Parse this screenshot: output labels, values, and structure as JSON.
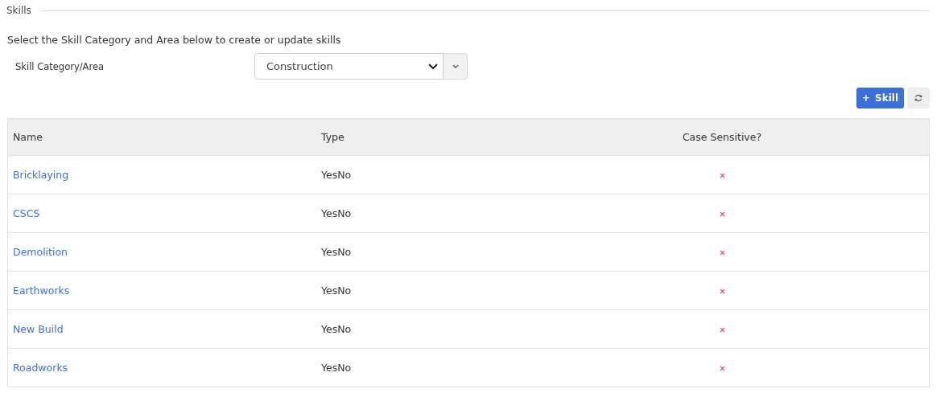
{
  "section": {
    "title": "Skills"
  },
  "intro": "Select the Skill Category and Area below to create or update skills",
  "category_field": {
    "label": "Skill Category/Area",
    "value": "Construction"
  },
  "add_button": {
    "icon": "+",
    "label": "Skill"
  },
  "table": {
    "columns": [
      "Name",
      "Type",
      "Case Sensitive?"
    ],
    "rows": [
      {
        "name": "Bricklaying",
        "type": "YesNo",
        "case_sensitive": false
      },
      {
        "name": "CSCS",
        "type": "YesNo",
        "case_sensitive": false
      },
      {
        "name": "Demolition",
        "type": "YesNo",
        "case_sensitive": false
      },
      {
        "name": "Earthworks",
        "type": "YesNo",
        "case_sensitive": false
      },
      {
        "name": "New Build",
        "type": "YesNo",
        "case_sensitive": false
      },
      {
        "name": "Roadworks",
        "type": "YesNo",
        "case_sensitive": false
      }
    ]
  }
}
